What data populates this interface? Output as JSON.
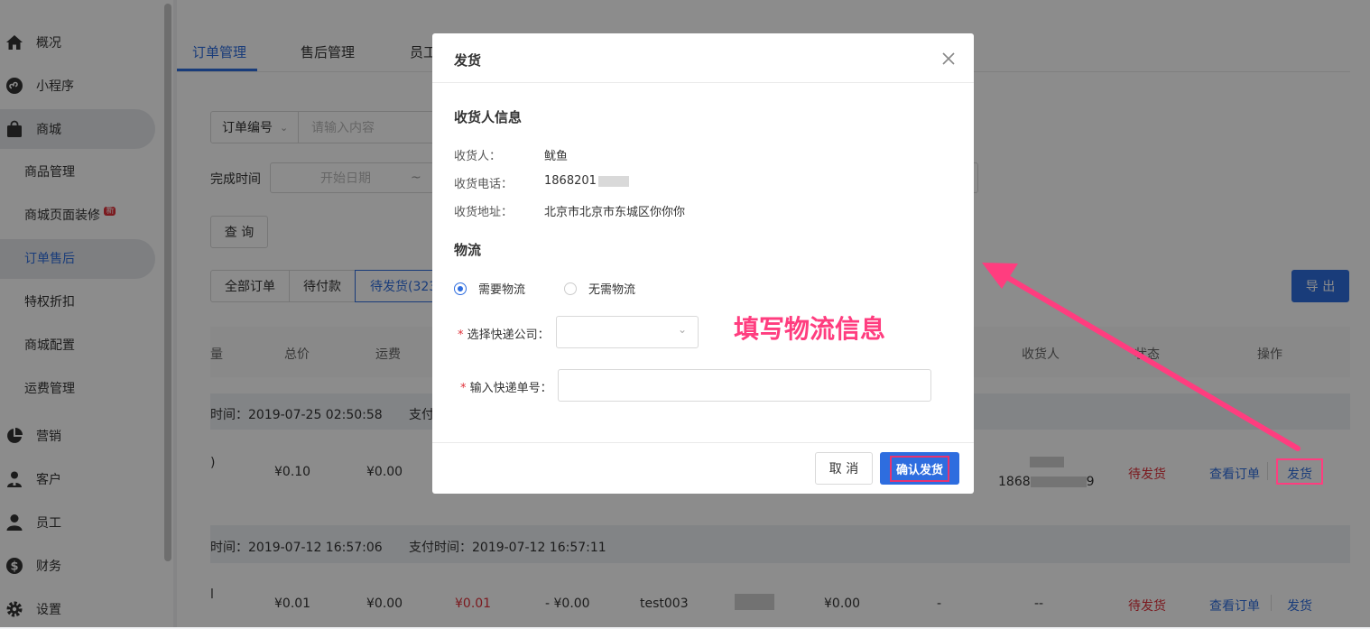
{
  "sidebar": {
    "items": [
      {
        "label": "概况",
        "icon": "home-icon"
      },
      {
        "label": "小程序",
        "icon": "miniapp-icon"
      },
      {
        "label": "商城",
        "icon": "bag-icon"
      },
      {
        "label": "营销",
        "icon": "piechart-icon"
      },
      {
        "label": "客户",
        "icon": "customer-icon"
      },
      {
        "label": "员工",
        "icon": "person-icon"
      },
      {
        "label": "财务",
        "icon": "dollar-icon"
      },
      {
        "label": "设置",
        "icon": "gear-icon"
      }
    ],
    "sub_items": [
      "商品管理",
      "商城页面装修",
      "订单售后",
      "特权折扣",
      "商城配置",
      "运费管理"
    ],
    "new_badge": "新"
  },
  "tabs": [
    "订单管理",
    "售后管理",
    "员工"
  ],
  "filters": {
    "order_field": "订单编号",
    "search_placeholder": "请输入内容",
    "finish_time_label": "完成时间",
    "start_date_placeholder": "开始日期",
    "range_sep": "~",
    "query_button": "查 询",
    "export_button": "导 出"
  },
  "status_tabs": [
    "全部订单",
    "待付款",
    "待发货(323"
  ],
  "table": {
    "headers": [
      "量",
      "总价",
      "运费",
      "收货人",
      "状态",
      "操作"
    ],
    "group1": {
      "time": "时间：2019-07-25 02:50:58",
      "pay_time": "支付"
    },
    "row1": {
      "qty": ")",
      "total": "¥0.10",
      "shipping": "¥0.00",
      "phone": "1868",
      "phone_tail": "9",
      "status": "待发货",
      "view": "查看订单",
      "ship": "发货"
    },
    "group2": {
      "time": "时间：2019-07-12 16:57:06",
      "pay_time": "支付时间：2019-07-12 16:57:11"
    },
    "row2": {
      "qty": "l",
      "total": "¥0.01",
      "shipping": "¥0.00",
      "paid": "¥0.01",
      "discount": "- ¥0.00",
      "user": "test003",
      "extra": "¥0.00",
      "dash1": "-",
      "dash2": "--",
      "status": "待发货",
      "view": "查看订单",
      "ship": "发货"
    }
  },
  "modal": {
    "title": "发货",
    "receiver_section": "收货人信息",
    "receiver_label": "收货人：",
    "receiver_value": "鱿鱼",
    "phone_label": "收货电话：",
    "phone_value": "1868201",
    "address_label": "收货地址：",
    "address_value": "北京市北京市东城区你你你",
    "logistics_section": "物流",
    "need_logistics": "需要物流",
    "no_logistics": "无需物流",
    "required_mark": "*",
    "company_label": "选择快递公司：",
    "tracking_label": "输入快递单号：",
    "cancel_button": "取 消",
    "confirm_button": "确认发货"
  },
  "annotation": {
    "text": "填写物流信息",
    "color": "#ff3d7f"
  },
  "colors": {
    "accent": "#2e6ddf",
    "danger": "#e0313a",
    "highlight": "#e8336e"
  }
}
